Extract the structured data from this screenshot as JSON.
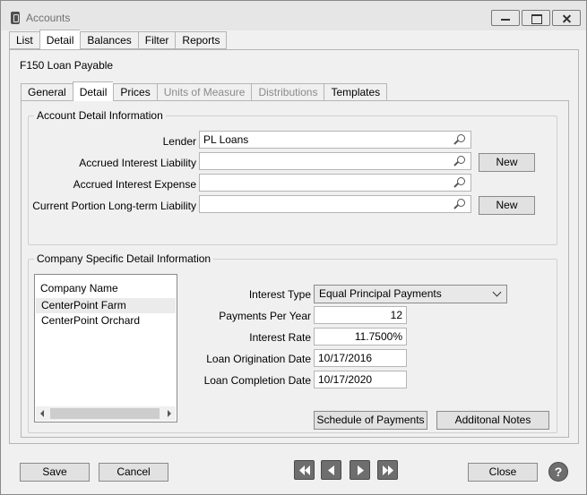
{
  "window": {
    "title": "Accounts"
  },
  "top_tabs": [
    {
      "label": "List",
      "active": false
    },
    {
      "label": "Detail",
      "active": true
    },
    {
      "label": "Balances",
      "active": false
    },
    {
      "label": "Filter",
      "active": false
    },
    {
      "label": "Reports",
      "active": false
    }
  ],
  "account": {
    "name": "F150 Loan Payable"
  },
  "inner_tabs": [
    {
      "label": "General",
      "active": false,
      "enabled": true
    },
    {
      "label": "Detail",
      "active": true,
      "enabled": true
    },
    {
      "label": "Prices",
      "active": false,
      "enabled": true
    },
    {
      "label": "Units of Measure",
      "active": false,
      "enabled": false
    },
    {
      "label": "Distributions",
      "active": false,
      "enabled": false
    },
    {
      "label": "Templates",
      "active": false,
      "enabled": true
    }
  ],
  "account_detail": {
    "legend": "Account Detail Information",
    "lender_label": "Lender",
    "lender_value": "PL Loans",
    "accrued_liability_label": "Accrued Interest Liability",
    "accrued_liability_value": "",
    "accrued_expense_label": "Accrued Interest Expense",
    "accrued_expense_value": "",
    "current_portion_label": "Current Portion Long-term Liability",
    "current_portion_value": "",
    "new_label": "New"
  },
  "company_detail": {
    "legend": "Company Specific Detail Information",
    "list_header": "Company Name",
    "companies": [
      "CenterPoint Farm",
      "CenterPoint Orchard"
    ],
    "interest_type_label": "Interest Type",
    "interest_type_value": "Equal Principal Payments",
    "payments_per_year_label": "Payments Per Year",
    "payments_per_year_value": "12",
    "interest_rate_label": "Interest Rate",
    "interest_rate_value": "11.7500%",
    "origination_label": "Loan Origination Date",
    "origination_value": "10/17/2016",
    "completion_label": "Loan Completion Date",
    "completion_value": "10/17/2020",
    "schedule_button": "Schedule of Payments",
    "notes_button": "Additonal Notes"
  },
  "footer": {
    "save": "Save",
    "cancel": "Cancel",
    "close": "Close",
    "help": "?"
  },
  "icons": {
    "lookup": "magnifier-icon",
    "nav_first": "first-record-icon",
    "nav_prev": "previous-record-icon",
    "nav_next": "next-record-icon",
    "nav_last": "last-record-icon",
    "help": "help-icon"
  }
}
